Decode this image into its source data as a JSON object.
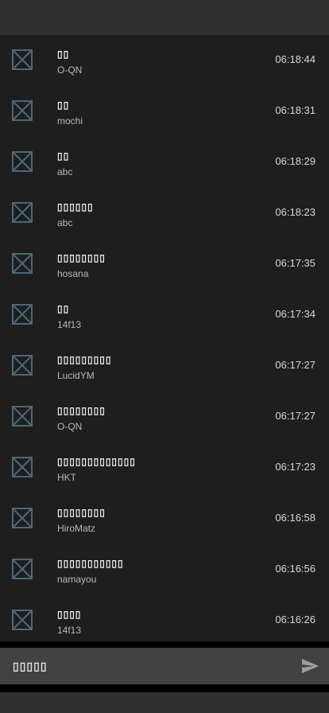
{
  "colors": {
    "header_bg": "#303030",
    "list_bg": "#1e1e1e",
    "composer_bg": "#424242",
    "avatar_stroke": "#4d6875"
  },
  "messages": [
    {
      "text": "▯▯",
      "user": "O-QN",
      "time": "06:18:44",
      "icon": "broken-image-icon"
    },
    {
      "text": "▯▯",
      "user": "mochi",
      "time": "06:18:31",
      "icon": "broken-image-icon"
    },
    {
      "text": "▯▯",
      "user": "abc",
      "time": "06:18:29",
      "icon": "broken-image-icon"
    },
    {
      "text": "▯▯▯▯▯▯",
      "user": "abc",
      "time": "06:18:23",
      "icon": "broken-image-icon"
    },
    {
      "text": "▯▯▯▯▯▯▯▯",
      "user": "hosana",
      "time": "06:17:35",
      "icon": "broken-image-icon"
    },
    {
      "text": "▯▯",
      "user": "14f13",
      "time": "06:17:34",
      "icon": "broken-image-icon"
    },
    {
      "text": "▯▯▯▯▯▯▯▯▯",
      "user": "LucidYM",
      "time": "06:17:27",
      "icon": "broken-image-icon"
    },
    {
      "text": "▯▯▯▯▯▯▯▯",
      "user": "O-QN",
      "time": "06:17:27",
      "icon": "broken-image-icon"
    },
    {
      "text": "▯▯▯▯▯▯▯▯▯▯▯▯▯",
      "user": "HKT",
      "time": "06:17:23",
      "icon": "broken-image-icon"
    },
    {
      "text": "▯▯▯▯▯▯▯▯",
      "user": "HiroMatz",
      "time": "06:16:58",
      "icon": "broken-image-icon"
    },
    {
      "text": "▯▯▯▯▯▯▯▯▯▯▯",
      "user": "namayou",
      "time": "06:16:56",
      "icon": "broken-image-icon"
    },
    {
      "text": "▯▯▯▯",
      "user": "14f13",
      "time": "06:16:26",
      "icon": "broken-image-icon"
    }
  ],
  "composer": {
    "placeholder": "▯▯▯▯▯",
    "send_icon": "send-icon"
  }
}
